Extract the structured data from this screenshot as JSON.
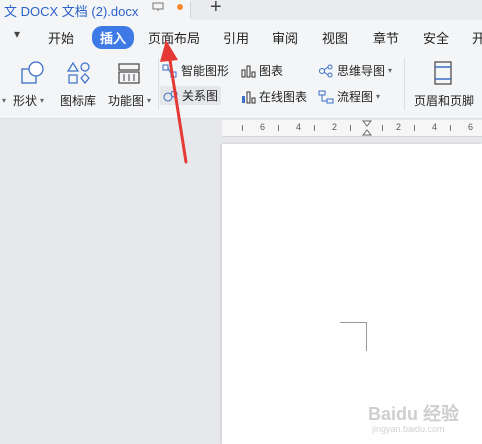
{
  "titlebar": {
    "doc_title": "文 DOCX 文档 (2).docx",
    "new_tab": "+"
  },
  "menu": {
    "collapse_icon": "chevron-down-icon",
    "items": [
      "开始",
      "插入",
      "页面布局",
      "引用",
      "审阅",
      "视图",
      "章节",
      "安全",
      "开"
    ],
    "active": "插入"
  },
  "ribbon": {
    "shape": "形状",
    "icon_library": "图标库",
    "function_chart": "功能图",
    "smart_graphic": "智能图形",
    "relationship": "关系图",
    "chart": "图表",
    "online_chart": "在线图表",
    "mindmap": "思维导图",
    "flowchart": "流程图",
    "header_footer": "页眉和页脚"
  },
  "ruler": {
    "labels": [
      "6",
      "4",
      "2",
      "2",
      "4",
      "6"
    ]
  },
  "watermark": {
    "text": "Baidu 经验",
    "sub": "jingyan.baidu.com"
  },
  "colors": {
    "accent": "#3d7ae5",
    "arrow": "#e53935",
    "tab_dot": "#f08a2c"
  }
}
